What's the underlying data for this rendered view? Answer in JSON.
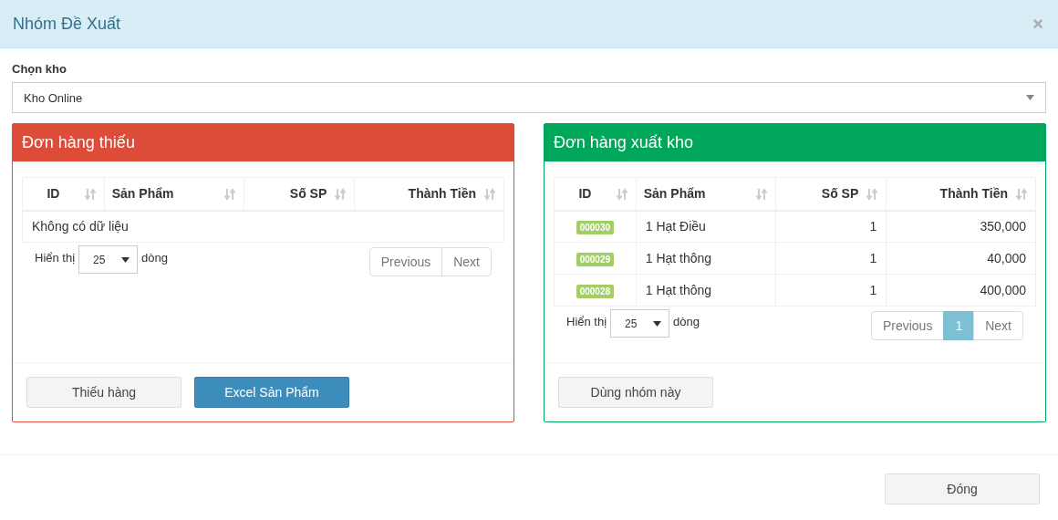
{
  "dialog": {
    "title": "Nhóm Đề Xuất",
    "close": "×"
  },
  "warehouse": {
    "label": "Chọn kho",
    "value": "Kho Online"
  },
  "panels": [
    {
      "title": "Đơn hàng thiếu",
      "color": "#dd4b39",
      "columns": [
        "ID",
        "Sản Phẩm",
        "Số SP",
        "Thành Tiền"
      ],
      "empty_text": "Không có dữ liệu",
      "length": {
        "before": "Hiển thị",
        "value": "25",
        "after": "dòng"
      },
      "pagination": [
        {
          "label": "Previous",
          "selected": false
        },
        {
          "label": "Next",
          "selected": false
        }
      ],
      "buttons": [
        {
          "label": "Thiếu hàng",
          "primary": false
        },
        {
          "label": "Excel Sản Phẩm",
          "primary": true
        }
      ]
    },
    {
      "title": "Đơn hàng xuất kho",
      "color": "#00a65a",
      "columns": [
        "ID",
        "Sản Phẩm",
        "Số SP",
        "Thành Tiền"
      ],
      "rows": [
        {
          "id": "000030",
          "product": "1 Hạt Điều",
          "qty": "1",
          "amount": "350,000"
        },
        {
          "id": "000029",
          "product": "1 Hạt thông",
          "qty": "1",
          "amount": "40,000"
        },
        {
          "id": "000028",
          "product": "1 Hạt thông",
          "qty": "1",
          "amount": "400,000"
        }
      ],
      "length": {
        "before": "Hiển thị",
        "value": "25",
        "after": "dòng"
      },
      "pagination": [
        {
          "label": "Previous",
          "selected": false
        },
        {
          "label": "1",
          "selected": true
        },
        {
          "label": "Next",
          "selected": false
        }
      ],
      "buttons": [
        {
          "label": "Dùng nhóm này",
          "primary": false
        }
      ]
    }
  ],
  "footer_buttons": [
    "Đóng"
  ]
}
